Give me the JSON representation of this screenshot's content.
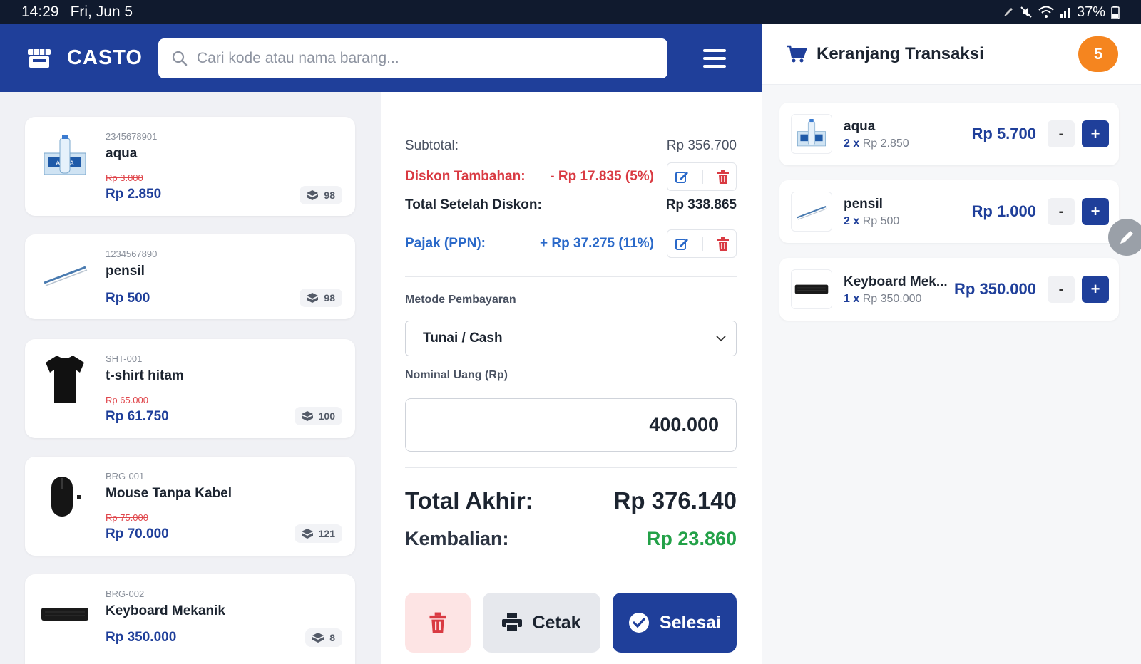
{
  "statusbar": {
    "time": "14:29",
    "date": "Fri, Jun 5",
    "battery": "37%"
  },
  "header": {
    "brand": "CASTO",
    "search_placeholder": "Cari kode atau nama barang..."
  },
  "products": [
    {
      "code": "2345678901",
      "name": "aqua",
      "old_price": "Rp 3.000",
      "price": "Rp 2.850",
      "stock": "98",
      "thumb": "water-box"
    },
    {
      "code": "1234567890",
      "name": "pensil",
      "old_price": "",
      "price": "Rp 500",
      "stock": "98",
      "thumb": "pencil"
    },
    {
      "code": "SHT-001",
      "name": "t-shirt hitam",
      "old_price": "Rp 65.000",
      "price": "Rp 61.750",
      "stock": "100",
      "thumb": "tshirt"
    },
    {
      "code": "BRG-001",
      "name": "Mouse Tanpa Kabel",
      "old_price": "Rp 75.000",
      "price": "Rp 70.000",
      "stock": "121",
      "thumb": "mouse"
    },
    {
      "code": "BRG-002",
      "name": "Keyboard Mekanik",
      "old_price": "",
      "price": "Rp 350.000",
      "stock": "8",
      "thumb": "keyboard"
    }
  ],
  "payment": {
    "subtotal_label": "Subtotal:",
    "subtotal_value": "Rp 356.700",
    "discount_label": "Diskon Tambahan:",
    "discount_value": "- Rp 17.835 (5%)",
    "after_discount_label": "Total Setelah Diskon:",
    "after_discount_value": "Rp 338.865",
    "tax_label": "Pajak (PPN):",
    "tax_value": "+ Rp 37.275 (11%)",
    "method_label": "Metode Pembayaran",
    "method_value": "Tunai / Cash",
    "amount_label": "Nominal Uang (Rp)",
    "amount_value": "400.000",
    "total_label": "Total Akhir:",
    "total_value": "Rp 376.140",
    "change_label": "Kembalian:",
    "change_value": "Rp 23.860",
    "print_label": "Cetak",
    "done_label": "Selesai"
  },
  "cart": {
    "title": "Keranjang Transaksi",
    "count": "5",
    "items": [
      {
        "name": "aqua",
        "qty": "2 x",
        "unit": "Rp 2.850",
        "total": "Rp 5.700"
      },
      {
        "name": "pensil",
        "qty": "2 x",
        "unit": "Rp 500",
        "total": "Rp 1.000"
      },
      {
        "name": "Keyboard Mek...",
        "qty": "1 x",
        "unit": "Rp 350.000",
        "total": "Rp 350.000"
      }
    ],
    "minus": "-",
    "plus": "+"
  },
  "colors": {
    "primary": "#1f3f9a",
    "accent": "#f5851f",
    "danger": "#d93a42",
    "success": "#23a148",
    "link": "#2a69c9"
  }
}
